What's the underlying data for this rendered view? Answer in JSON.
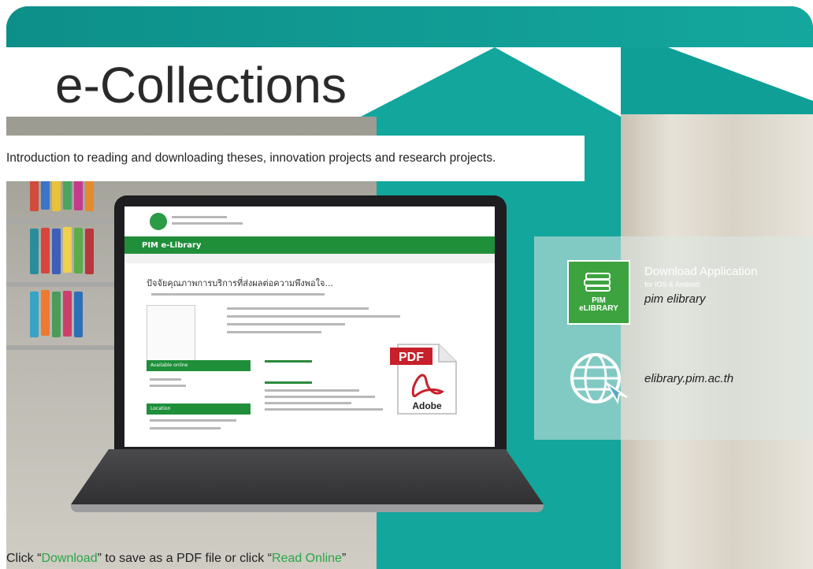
{
  "title": "e-Collections",
  "intro": "Introduction to reading and downloading theses, innovation projects and research projects.",
  "screen": {
    "brand": "PIM e-Library",
    "thai_title": "ปัจจัยคุณภาพการบริการที่ส่งผลต่อความพึงพอใจ...",
    "available_online": "Available online",
    "location": "Location"
  },
  "pdf": {
    "label": "PDF",
    "brand": "Adobe"
  },
  "app": {
    "download_title": "Download Application",
    "platforms": "for IOS & Android",
    "name": "pim elibrary",
    "badge_line1": "PIM",
    "badge_line2": "eLIBRARY"
  },
  "website": "elibrary.pim.ac.th",
  "bottom": {
    "prefix": "Click “",
    "download": "Download",
    "middle": "” to save as a PDF file or click “",
    "read": "Read Online",
    "suffix": "”"
  },
  "colors": {
    "teal": "#0f9f97",
    "green": "#28a745",
    "badge_green": "#3ca33f"
  }
}
